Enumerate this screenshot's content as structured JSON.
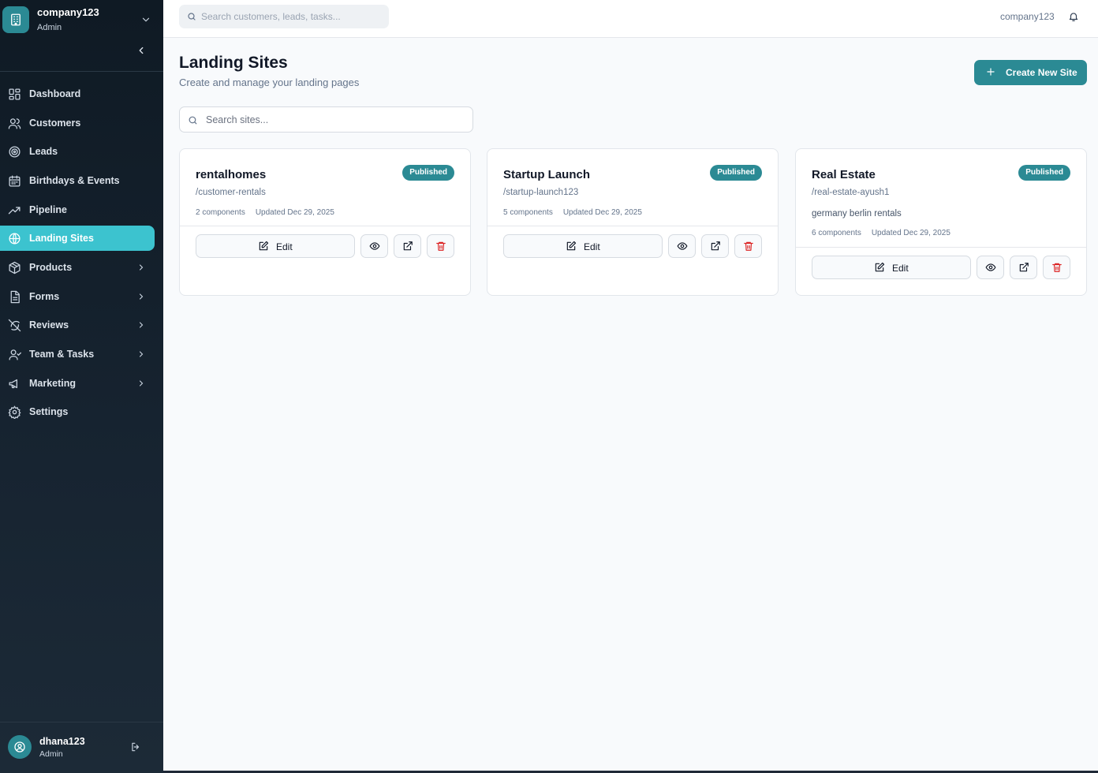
{
  "sidebar": {
    "company": "company123",
    "role": "Admin",
    "items": [
      {
        "label": "Dashboard",
        "icon": "dashboard-icon"
      },
      {
        "label": "Customers",
        "icon": "users-icon"
      },
      {
        "label": "Leads",
        "icon": "target-icon"
      },
      {
        "label": "Birthdays & Events",
        "icon": "calendar-icon"
      },
      {
        "label": "Pipeline",
        "icon": "trend-icon"
      },
      {
        "label": "Landing Sites",
        "icon": "globe-icon",
        "active": true
      },
      {
        "label": "Products",
        "icon": "box-icon",
        "expandable": true
      },
      {
        "label": "Forms",
        "icon": "document-icon",
        "expandable": true
      },
      {
        "label": "Reviews",
        "icon": "reviews-icon",
        "expandable": true
      },
      {
        "label": "Team & Tasks",
        "icon": "team-icon",
        "expandable": true
      },
      {
        "label": "Marketing",
        "icon": "megaphone-icon",
        "expandable": true
      },
      {
        "label": "Settings",
        "icon": "gear-icon"
      }
    ],
    "user": {
      "name": "dhana123",
      "role": "Admin"
    }
  },
  "topbar": {
    "search_placeholder": "Search customers, leads, tasks...",
    "company": "company123"
  },
  "main": {
    "title": "Landing Sites",
    "subtitle": "Create and manage your landing pages",
    "create_label": "Create New Site",
    "search_placeholder": "Search sites..."
  },
  "sites": [
    {
      "name": "rentalhomes",
      "status": "Published",
      "slug": "/customer-rentals",
      "description": "",
      "components": "2 components",
      "updated": "Updated Dec 29, 2025",
      "edit_label": "Edit"
    },
    {
      "name": "Startup Launch",
      "status": "Published",
      "slug": "/startup-launch123",
      "description": "",
      "components": "5 components",
      "updated": "Updated Dec 29, 2025",
      "edit_label": "Edit"
    },
    {
      "name": "Real Estate",
      "status": "Published",
      "slug": "/real-estate-ayush1",
      "description": "germany berlin rentals",
      "components": "6 components",
      "updated": "Updated Dec 29, 2025",
      "edit_label": "Edit"
    }
  ],
  "colors": {
    "accent": "#2b8a94",
    "active_nav": "#3cc3cf",
    "danger": "#dc2626",
    "sidebar_bg": "#0f1a24"
  }
}
